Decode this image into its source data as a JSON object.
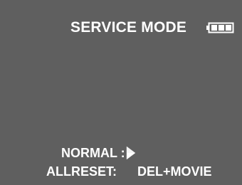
{
  "screen": {
    "title": "SERVICE MODE",
    "battery_icon": "battery-full-icon",
    "options": [
      {
        "label": "NORMAL :",
        "value": "",
        "indicator": "arrow-right-icon"
      },
      {
        "label": "ALLRESET:",
        "value": "DEL+MOVIE"
      }
    ]
  },
  "colors": {
    "background": "#5f5f5f",
    "text": "#ffffff"
  }
}
